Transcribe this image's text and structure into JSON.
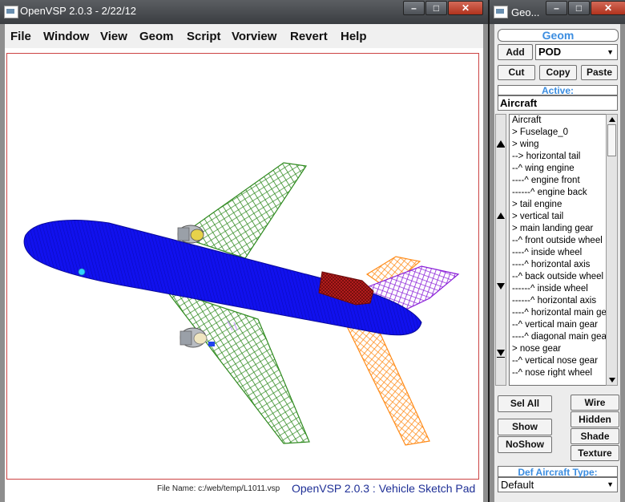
{
  "main_window": {
    "title": "OpenVSP 2.0.3 - 2/22/12",
    "menu": [
      "File",
      "Window",
      "View",
      "Geom",
      "Script",
      "Vorview",
      "Revert",
      "Help"
    ],
    "status": {
      "file_label": "File Name:",
      "file_path": "c:/web/temp/L1011.vsp",
      "brand": "OpenVSP 2.0.3 : Vehicle Sketch Pad"
    }
  },
  "geom_window": {
    "title": "Geo...",
    "header": "Geom",
    "add_label": "Add",
    "type_select": "POD",
    "cut_label": "Cut",
    "copy_label": "Copy",
    "paste_label": "Paste",
    "active_label": "Active:",
    "active_value": "Aircraft",
    "components": [
      "Aircraft",
      "> Fuselage_0",
      "> wing",
      "--> horizontal tail",
      "--^ wing engine",
      "----^ engine front",
      "------^ engine back",
      "> tail engine",
      "> vertical tail",
      "> main landing gear",
      "--^ front outside wheel",
      "----^ inside wheel",
      "----^ horizontal axis",
      "--^ back outside wheel",
      "------^ inside wheel",
      "------^ horizontal axis",
      "----^ horizontal main gear",
      "--^ vertical main gear",
      "----^ diagonal main gear",
      "> nose gear",
      "--^ vertical nose gear",
      "--^ nose right wheel"
    ],
    "sel_all_label": "Sel All",
    "show_label": "Show",
    "noshow_label": "NoShow",
    "wire_label": "Wire",
    "hidden_label": "Hidden",
    "shade_label": "Shade",
    "texture_label": "Texture",
    "def_type_label": "Def Aircraft Type:",
    "def_type_value": "Default"
  },
  "colors": {
    "fuselage": "#1111ee",
    "wing": "#2f8a1f",
    "horizontal_tail": "#ff8c1a",
    "vertical_tail": "#8a1fd8",
    "tail_engine": "#8a1010",
    "wing_engine": "#9aa0a8",
    "accent_blue": "#3b8de0",
    "brand_blue": "#1e2f96"
  }
}
